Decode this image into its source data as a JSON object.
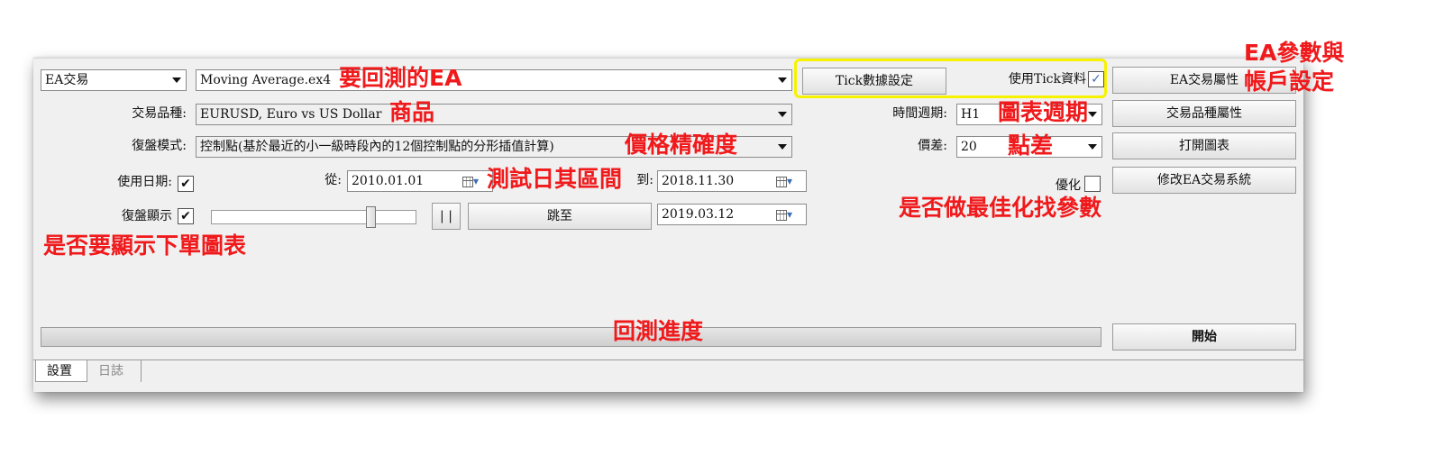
{
  "row1": {
    "mode_select": "EA交易",
    "ea_file": "Moving Average.ex4",
    "tick_button": "Tick數據設定",
    "use_tick_label": "使用Tick資料",
    "use_tick_check": "✓",
    "ea_props_button": "EA交易屬性"
  },
  "row2": {
    "symbol_label": "交易品種:",
    "symbol_value": "EURUSD, Euro vs US Dollar",
    "period_label": "時間週期:",
    "period_value": "H1",
    "symbol_props_button": "交易品種屬性"
  },
  "row3": {
    "model_label": "復盤模式:",
    "model_value": "控制點(基於最近的小一級時段內的12個控制點的分形插值計算)",
    "spread_label": "價差:",
    "spread_value": "20",
    "open_chart_button": "打開圖表"
  },
  "row4": {
    "use_date_label": "使用日期:",
    "use_date_check": "✔",
    "from_label": "從:",
    "from_value": "2010.01.01",
    "to_label": "到:",
    "to_value": "2018.11.30",
    "optimize_label": "優化",
    "modify_ea_button": "修改EA交易系統"
  },
  "row5": {
    "visual_label": "復盤顯示",
    "visual_check": "✔",
    "pause_button": "| |",
    "skip_button": "跳至",
    "skip_date": "2019.03.12"
  },
  "start_button": "開始",
  "progress": {
    "value": 0
  },
  "tabs": [
    {
      "label": "設置",
      "active": true
    },
    {
      "label": "日誌",
      "active": false
    }
  ],
  "annotations": {
    "ea": "要回測的EA",
    "symbol": "商品",
    "precision": "價格精確度",
    "date_range": "測試日其區間",
    "period": "圖表週期",
    "spread": "點差",
    "ea_params_line1": "EA參數與",
    "ea_params_line2": "帳戶設定",
    "optimize": "是否做最佳化找參數",
    "visual": "是否要顯示下單圖表",
    "progress": "回測進度"
  },
  "colors": {
    "annotation": "#f0191b",
    "highlight": "#f7f200",
    "panel": "#f0f0f0"
  }
}
